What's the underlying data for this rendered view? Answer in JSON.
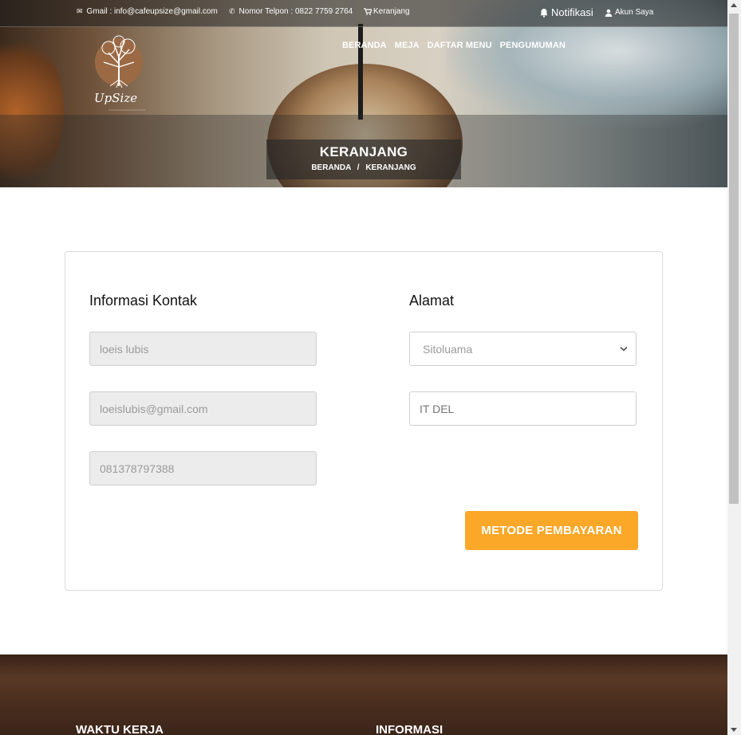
{
  "topbar": {
    "email": "Gmail : info@cafeupsize@gmail.com",
    "phone": "Nomor Telpon : 0822 7759 2764",
    "cart": "Keranjang",
    "notif": "Notifikasi",
    "account": "Akun Saya"
  },
  "brand": {
    "logo_text": "UpSize"
  },
  "nav": {
    "items": [
      {
        "label": "BERANDA"
      },
      {
        "label": "MEJA"
      },
      {
        "label": "DAFTAR MENU"
      },
      {
        "label": "PENGUMUMAN"
      }
    ]
  },
  "banner": {
    "title": "KERANJANG",
    "crumb_home": "BERANDA",
    "crumb_sep": "/",
    "crumb_current": "KERANJANG"
  },
  "form": {
    "contact_title": "Informasi Kontak",
    "address_title": "Alamat",
    "name_value": "loeis lubis",
    "email_value": "loeislubis@gmail.com",
    "phone_value": "081378797388",
    "city_selected": "Sitoluama",
    "address_placeholder": "IT DEL",
    "submit_label": "METODE PEMBAYARAN"
  },
  "footer": {
    "col1_title": "WAKTU KERJA",
    "col2_title": "INFORMASI"
  },
  "colors": {
    "accent": "#fba728"
  }
}
